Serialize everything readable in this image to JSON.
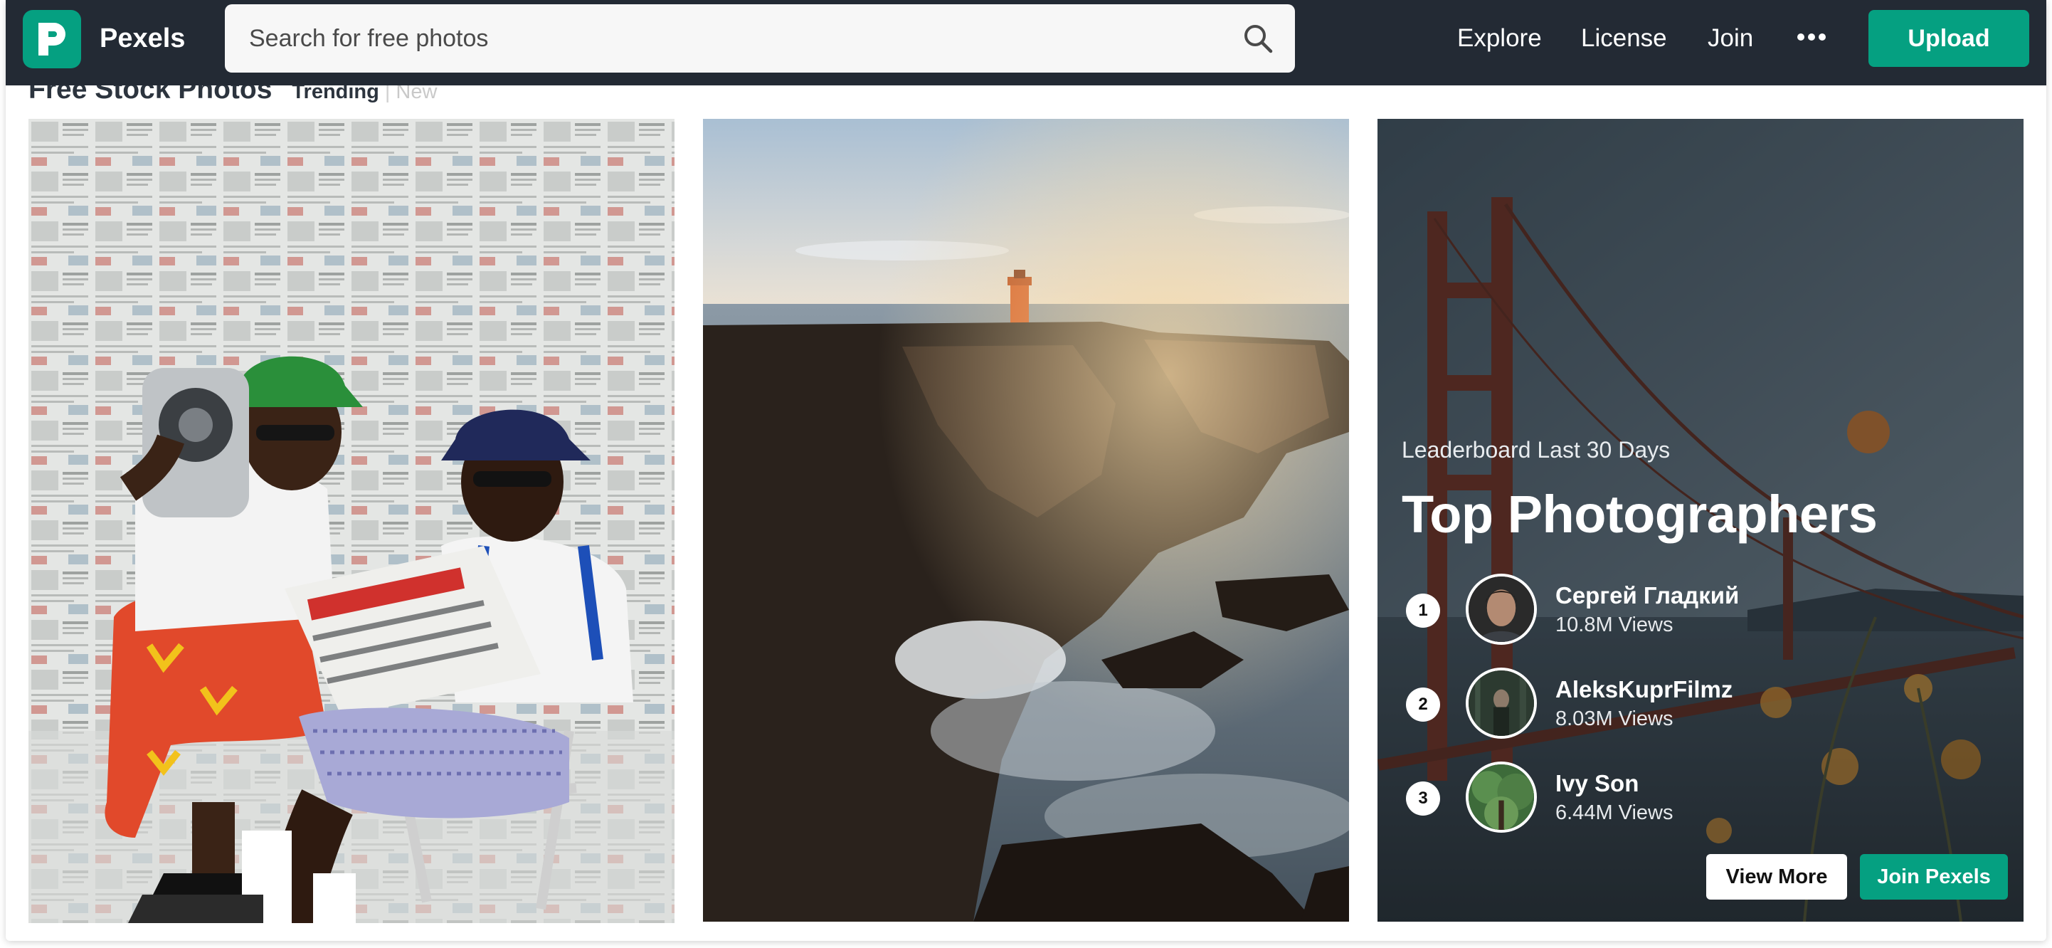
{
  "header": {
    "brand": "Pexels",
    "logo_icon": "pexels-logo-icon",
    "search": {
      "placeholder": "Search for free photos",
      "icon": "search-icon"
    },
    "nav": {
      "explore": "Explore",
      "license": "License",
      "join": "Join",
      "more_icon": "more-dots-icon"
    },
    "upload_label": "Upload"
  },
  "section": {
    "title": "Free Stock Photos",
    "filters": {
      "active": "Trending",
      "separator": "|",
      "inactive": "New"
    }
  },
  "leaderboard": {
    "subtitle": "Leaderboard Last 30 Days",
    "title": "Top Photographers",
    "photographers": [
      {
        "rank": "1",
        "name": "Сергей Гладкий",
        "views": "10.8M Views"
      },
      {
        "rank": "2",
        "name": "AleksKuprFilmz",
        "views": "8.03M Views"
      },
      {
        "rank": "3",
        "name": "Ivy Son",
        "views": "6.44M Views"
      }
    ],
    "view_more_label": "View More",
    "join_label": "Join Pexels"
  },
  "colors": {
    "brand_green": "#05a081",
    "header_bg": "#232a34",
    "title_text": "#2c343e"
  }
}
